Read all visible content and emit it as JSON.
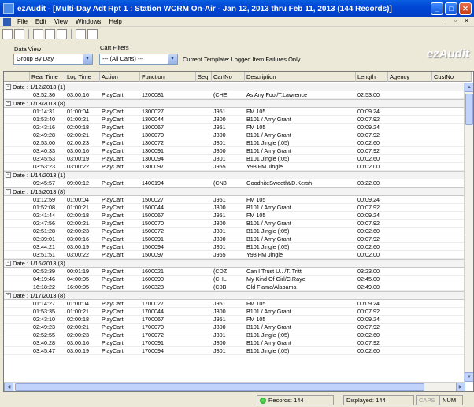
{
  "window": {
    "title": "ezAudit - [Multi-Day Adt Rpt 1 :  Station WCRM On-Air - Jan 12, 2013 thru Feb 11, 2013 (144 Records)]"
  },
  "menu": [
    "File",
    "Edit",
    "View",
    "Windows",
    "Help"
  ],
  "toolbar_icons": [
    "new-icon",
    "open-icon",
    "report-icon",
    "print-icon",
    "save-icon",
    "help-icon",
    "about-icon"
  ],
  "filters": {
    "data_view_label": "Data View",
    "data_view_value": "Group By Day",
    "cart_filters_label": "Cart Filters",
    "cart_filters_value": "--- (All Carts) ---",
    "template_text": "Current Template: Logged Item Failures Only"
  },
  "brand": "ezAudit",
  "columns": [
    "",
    "Real Time",
    "Log Time",
    "Action",
    "Function",
    "Seq",
    "CartNo",
    "Description",
    "Length",
    "Agency",
    "CustNo"
  ],
  "groups": [
    {
      "label": "Date : 1/12/2013 (1)",
      "rows": [
        [
          "03:52:36",
          "03:00:16",
          "PlayCart",
          "1200081",
          "(CHE",
          "As Any Fool/T.Lawrence",
          "02:53:00"
        ]
      ]
    },
    {
      "label": "Date : 1/13/2013 (8)",
      "rows": [
        [
          "01:14:31",
          "01:00:04",
          "PlayCart",
          "1300027",
          "J951",
          "FM 105",
          "00:09.24"
        ],
        [
          "01:53:40",
          "01:00:21",
          "PlayCart",
          "1300044",
          "J800",
          "B101 / Amy Grant",
          "00:07.92"
        ],
        [
          "02:43:16",
          "02:00:18",
          "PlayCart",
          "1300067",
          "J951",
          "FM 105",
          "00:09.24"
        ],
        [
          "02:49:28",
          "02:00:21",
          "PlayCart",
          "1300070",
          "J800",
          "B101 / Amy Grant",
          "00:07.92"
        ],
        [
          "02:53:00",
          "02:00:23",
          "PlayCart",
          "1300072",
          "J801",
          "B101 Jingle (:05)",
          "00:02.60"
        ],
        [
          "03:40:33",
          "03:00:16",
          "PlayCart",
          "1300091",
          "J800",
          "B101 / Amy Grant",
          "00:07.92"
        ],
        [
          "03:45:53",
          "03:00:19",
          "PlayCart",
          "1300094",
          "J801",
          "B101 Jingle (:05)",
          "00:02.60"
        ],
        [
          "03:53:23",
          "03:00:22",
          "PlayCart",
          "1300097",
          "J955",
          "Y98 FM Jingle",
          "00:02.00"
        ]
      ]
    },
    {
      "label": "Date : 1/14/2013 (1)",
      "rows": [
        [
          "09:45:57",
          "09:00:12",
          "PlayCart",
          "1400194",
          "(CN8",
          "GoodniteSweetht/D.Kersh",
          "03:22.00"
        ]
      ]
    },
    {
      "label": "Date : 1/15/2013 (8)",
      "rows": [
        [
          "01:12:59",
          "01:00:04",
          "PlayCart",
          "1500027",
          "J951",
          "FM 105",
          "00:09.24"
        ],
        [
          "01:52:08",
          "01:00:21",
          "PlayCart",
          "1500044",
          "J800",
          "B101 / Amy Grant",
          "00:07.92"
        ],
        [
          "02:41:44",
          "02:00:18",
          "PlayCart",
          "1500067",
          "J951",
          "FM 105",
          "00:09.24"
        ],
        [
          "02:47:56",
          "02:00:21",
          "PlayCart",
          "1500070",
          "J800",
          "B101 / Amy Grant",
          "00:07.92"
        ],
        [
          "02:51:28",
          "02:00:23",
          "PlayCart",
          "1500072",
          "J801",
          "B101 Jingle (:05)",
          "00:02.60"
        ],
        [
          "03:39:01",
          "03:00:16",
          "PlayCart",
          "1500091",
          "J800",
          "B101 / Amy Grant",
          "00:07.92"
        ],
        [
          "03:44:21",
          "03:00:19",
          "PlayCart",
          "1500094",
          "J801",
          "B101 Jingle (:05)",
          "00:02.60"
        ],
        [
          "03:51:51",
          "03:00:22",
          "PlayCart",
          "1500097",
          "J955",
          "Y98 FM Jingle",
          "00:02.00"
        ]
      ]
    },
    {
      "label": "Date : 1/16/2013 (3)",
      "rows": [
        [
          "00:53:39",
          "00:01:19",
          "PlayCart",
          "1600021",
          "(CDZ",
          "Can I Trust U.. /T. Tritt",
          "03:23.00"
        ],
        [
          "04:19:46",
          "04:00:05",
          "PlayCart",
          "1600090",
          "(CHL",
          "My Kind Of Girl/C.Raye",
          "02:45.00"
        ],
        [
          "16:18:22",
          "16:00:05",
          "PlayCart",
          "1600323",
          "(C0B",
          "Old Flame/Alabama",
          "02:49.00"
        ]
      ]
    },
    {
      "label": "Date : 1/17/2013 (8)",
      "rows": [
        [
          "01:14:27",
          "01:00:04",
          "PlayCart",
          "1700027",
          "J951",
          "FM 105",
          "00:09.24"
        ],
        [
          "01:53:35",
          "01:00:21",
          "PlayCart",
          "1700044",
          "J800",
          "B101 / Amy Grant",
          "00:07.92"
        ],
        [
          "02:43:10",
          "02:00:18",
          "PlayCart",
          "1700067",
          "J951",
          "FM 105",
          "00:09.24"
        ],
        [
          "02:49:23",
          "02:00:21",
          "PlayCart",
          "1700070",
          "J800",
          "B101 / Amy Grant",
          "00:07.92"
        ],
        [
          "02:52:55",
          "02:00:23",
          "PlayCart",
          "1700072",
          "J801",
          "B101 Jingle (:05)",
          "00:02.60"
        ],
        [
          "03:40:28",
          "03:00:16",
          "PlayCart",
          "1700091",
          "J800",
          "B101 / Amy Grant",
          "00:07.92"
        ],
        [
          "03:45:47",
          "03:00:19",
          "PlayCart",
          "1700094",
          "J801",
          "B101 Jingle (:05)",
          "00:02.60"
        ]
      ]
    }
  ],
  "status": {
    "records": "Records: 144",
    "displayed": "Displayed: 144",
    "caps": "CAPS",
    "num": "NUM"
  }
}
